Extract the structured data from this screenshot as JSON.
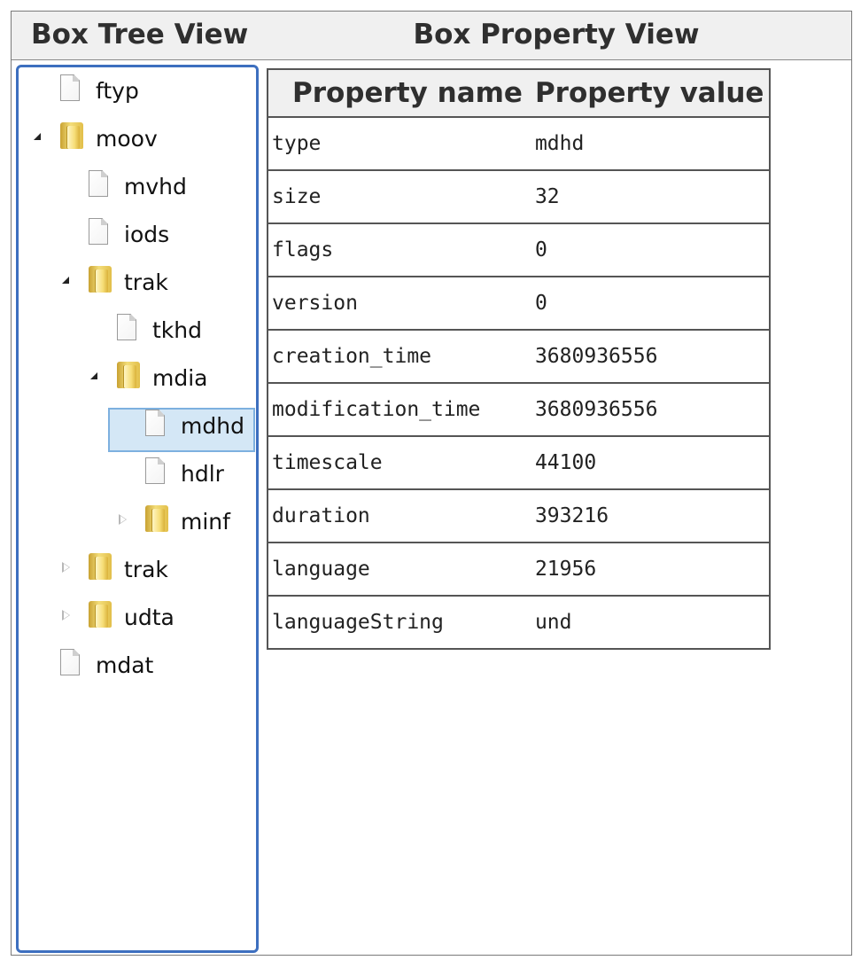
{
  "headers": {
    "tree": "Box Tree View",
    "properties": "Box Property View"
  },
  "tree": {
    "nodes": [
      {
        "label": "ftyp",
        "type": "file",
        "expander": "none",
        "depth": 0
      },
      {
        "label": "moov",
        "type": "folder",
        "expander": "open",
        "depth": 0
      },
      {
        "label": "mvhd",
        "type": "file",
        "expander": "none",
        "depth": 1
      },
      {
        "label": "iods",
        "type": "file",
        "expander": "none",
        "depth": 1
      },
      {
        "label": "trak",
        "type": "folder",
        "expander": "open",
        "depth": 1
      },
      {
        "label": "tkhd",
        "type": "file",
        "expander": "none",
        "depth": 2
      },
      {
        "label": "mdia",
        "type": "folder",
        "expander": "open",
        "depth": 2
      },
      {
        "label": "mdhd",
        "type": "file",
        "expander": "none",
        "depth": 3,
        "selected": true
      },
      {
        "label": "hdlr",
        "type": "file",
        "expander": "none",
        "depth": 3
      },
      {
        "label": "minf",
        "type": "folder",
        "expander": "closed",
        "depth": 3
      },
      {
        "label": "trak",
        "type": "folder",
        "expander": "closed",
        "depth": 1
      },
      {
        "label": "udta",
        "type": "folder",
        "expander": "closed",
        "depth": 1
      },
      {
        "label": "mdat",
        "type": "file",
        "expander": "none",
        "depth": 0
      }
    ]
  },
  "property_table": {
    "columns": [
      "Property name",
      "Property value"
    ],
    "rows": [
      {
        "name": "type",
        "value": "mdhd"
      },
      {
        "name": "size",
        "value": "32"
      },
      {
        "name": "flags",
        "value": "0"
      },
      {
        "name": "version",
        "value": "0"
      },
      {
        "name": "creation_time",
        "value": "3680936556"
      },
      {
        "name": "modification_time",
        "value": "3680936556"
      },
      {
        "name": "timescale",
        "value": "44100"
      },
      {
        "name": "duration",
        "value": "393216"
      },
      {
        "name": "language",
        "value": "21956"
      },
      {
        "name": "languageString",
        "value": "und"
      }
    ]
  },
  "colors": {
    "tree_border": "#3d6fbf",
    "selection_fill": "#d4e7f6",
    "selection_border": "#7db0df",
    "header_bg": "#f0f0f0"
  }
}
